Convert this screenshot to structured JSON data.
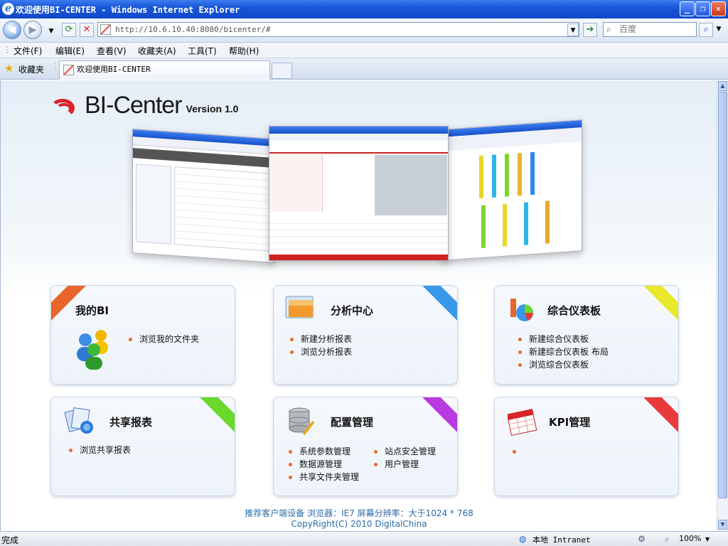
{
  "window": {
    "title": "欢迎使用BI-CENTER - Windows Internet Explorer",
    "minimize": "_",
    "maximize": "❐",
    "close": "✕"
  },
  "toolbar": {
    "url": "http://10.6.10.40:8080/bicenter/#",
    "search_placeholder": "百度"
  },
  "menu": {
    "items": [
      "文件(F)",
      "编辑(E)",
      "查看(V)",
      "收藏夹(A)",
      "工具(T)",
      "帮助(H)"
    ]
  },
  "favorites_label": "收藏夹",
  "tab": {
    "label": "欢迎使用BI-CENTER"
  },
  "header": {
    "brand": "BI-Center",
    "version": "Version 1.0"
  },
  "cards": {
    "mybi": {
      "title": "我的BI",
      "links": [
        "浏览我的文件夹"
      ],
      "ribbon_color": "#e8652c"
    },
    "analysis": {
      "title": "分析中心",
      "links": [
        "新建分析报表",
        "浏览分析报表"
      ],
      "ribbon_color": "#3a98e8"
    },
    "dashboard": {
      "title": "综合仪表板",
      "links": [
        "新建综合仪表板",
        "新建综合仪表板 布局",
        "浏览综合仪表板"
      ],
      "ribbon_color": "#e8e82c"
    },
    "shared": {
      "title": "共享报表",
      "links": [
        "浏览共享报表"
      ],
      "ribbon_color": "#6ad82c"
    },
    "config": {
      "title": "配置管理",
      "links_left": [
        "系统参数管理",
        "数据源管理",
        "共享文件夹管理"
      ],
      "links_right": [
        "站点安全管理",
        "用户管理"
      ],
      "ribbon_color": "#b83ae0"
    },
    "kpi": {
      "title": "KPI管理",
      "links": [
        "",
        "",
        ""
      ],
      "ribbon_color": "#e83a3a"
    }
  },
  "footer": {
    "recommend": "推荐客户端设备 浏览器：IE7 屏幕分辨率：大于1024 * 768",
    "copyright": "CopyRight(C) 2010 DigitalChina"
  },
  "status": {
    "left": "完成",
    "zone": "本地 Intranet",
    "zoom": "100%"
  }
}
